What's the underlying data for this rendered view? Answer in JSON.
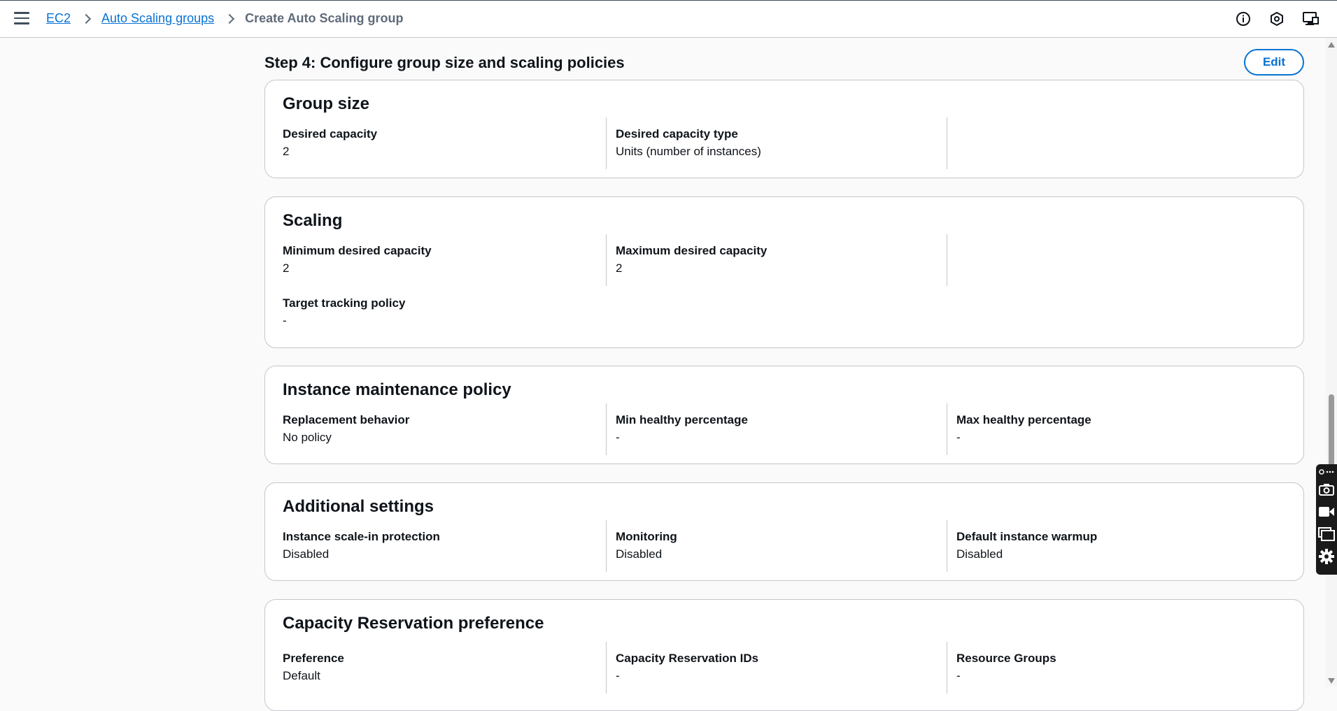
{
  "breadcrumb": {
    "items": [
      "EC2",
      "Auto Scaling groups"
    ],
    "current": "Create Auto Scaling group"
  },
  "step": {
    "title": "Step 4: Configure group size and scaling policies",
    "edit_label": "Edit"
  },
  "group_size": {
    "title": "Group size",
    "desired_capacity_label": "Desired capacity",
    "desired_capacity_value": "2",
    "desired_capacity_type_label": "Desired capacity type",
    "desired_capacity_type_value": "Units (number of instances)"
  },
  "scaling": {
    "title": "Scaling",
    "min_label": "Minimum desired capacity",
    "min_value": "2",
    "max_label": "Maximum desired capacity",
    "max_value": "2",
    "target_tracking_label": "Target tracking policy",
    "target_tracking_value": "-"
  },
  "maintenance": {
    "title": "Instance maintenance policy",
    "replacement_label": "Replacement behavior",
    "replacement_value": "No policy",
    "min_healthy_label": "Min healthy percentage",
    "min_healthy_value": "-",
    "max_healthy_label": "Max healthy percentage",
    "max_healthy_value": "-"
  },
  "additional": {
    "title": "Additional settings",
    "scale_in_label": "Instance scale-in protection",
    "scale_in_value": "Disabled",
    "monitoring_label": "Monitoring",
    "monitoring_value": "Disabled",
    "warmup_label": "Default instance warmup",
    "warmup_value": "Disabled"
  },
  "capacity_reservation": {
    "title": "Capacity Reservation preference",
    "preference_label": "Preference",
    "preference_value": "Default",
    "ids_label": "Capacity Reservation IDs",
    "ids_value": "-",
    "resource_groups_label": "Resource Groups",
    "resource_groups_value": "-"
  },
  "icons": {
    "menu": "hamburger-menu-icon",
    "info": "info-icon",
    "notifications": "hexagon-icon",
    "feedback": "screen-feedback-icon"
  },
  "colors": {
    "link": "#0972d3",
    "text": "#0f141a",
    "border": "#c6c6cd",
    "background": "#fafafa"
  }
}
